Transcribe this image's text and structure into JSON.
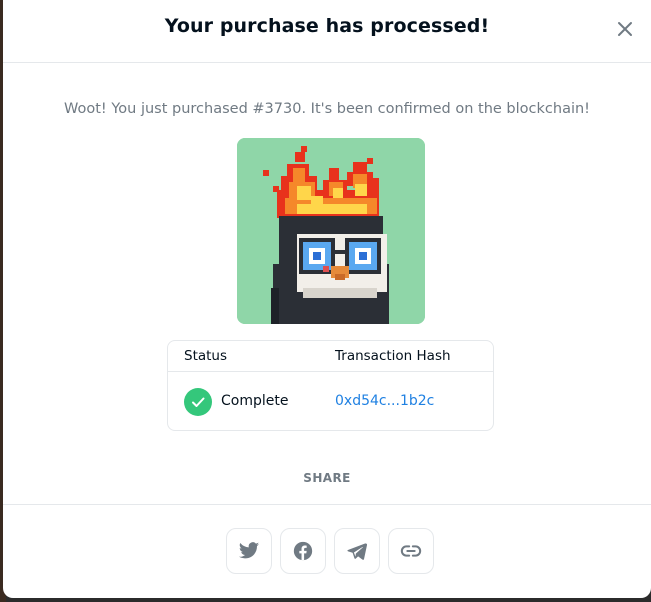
{
  "modal": {
    "title": "Your purchase has processed!",
    "message": "Woot! You just purchased #3730. It's been confirmed on the blockchain!"
  },
  "status_table": {
    "headers": {
      "status": "Status",
      "hash": "Transaction Hash"
    },
    "row": {
      "status": "Complete",
      "hash": "0xd54c...1b2c"
    }
  },
  "share": {
    "label": "SHARE",
    "buttons": [
      {
        "icon": "twitter-icon"
      },
      {
        "icon": "facebook-icon"
      },
      {
        "icon": "telegram-icon"
      },
      {
        "icon": "link-icon"
      }
    ]
  },
  "colors": {
    "title": "#04111d",
    "muted": "#707a83",
    "link": "#2081e2",
    "success": "#34c77b",
    "nft_background": "#8fd6a8"
  }
}
